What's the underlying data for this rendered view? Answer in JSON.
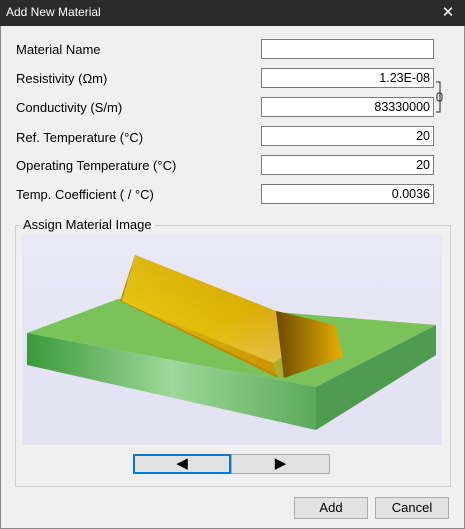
{
  "window": {
    "title": "Add New Material",
    "close_glyph": "✕"
  },
  "fields": [
    {
      "label": "Material Name",
      "value": ""
    },
    {
      "label": "Resistivity (Ωm)",
      "value": "1.23E-08"
    },
    {
      "label": "Conductivity (S/m)",
      "value": "83330000"
    },
    {
      "label": "Ref. Temperature (°C)",
      "value": "20"
    },
    {
      "label": "Operating Temperature (°C)",
      "value": "20"
    },
    {
      "label": "Temp. Coefficient ( / °C)",
      "value": "0.0036"
    }
  ],
  "image_group": {
    "label": "Assign Material Image",
    "prev_glyph": "◀",
    "next_glyph": "▶"
  },
  "buttons": {
    "add": "Add",
    "cancel": "Cancel"
  },
  "colors": {
    "titlebar": "#2b2b2b",
    "accent": "#0078d7",
    "plate": "#7ac25a",
    "metal": "#e8b400",
    "image_bg": "#e6e6f5"
  }
}
